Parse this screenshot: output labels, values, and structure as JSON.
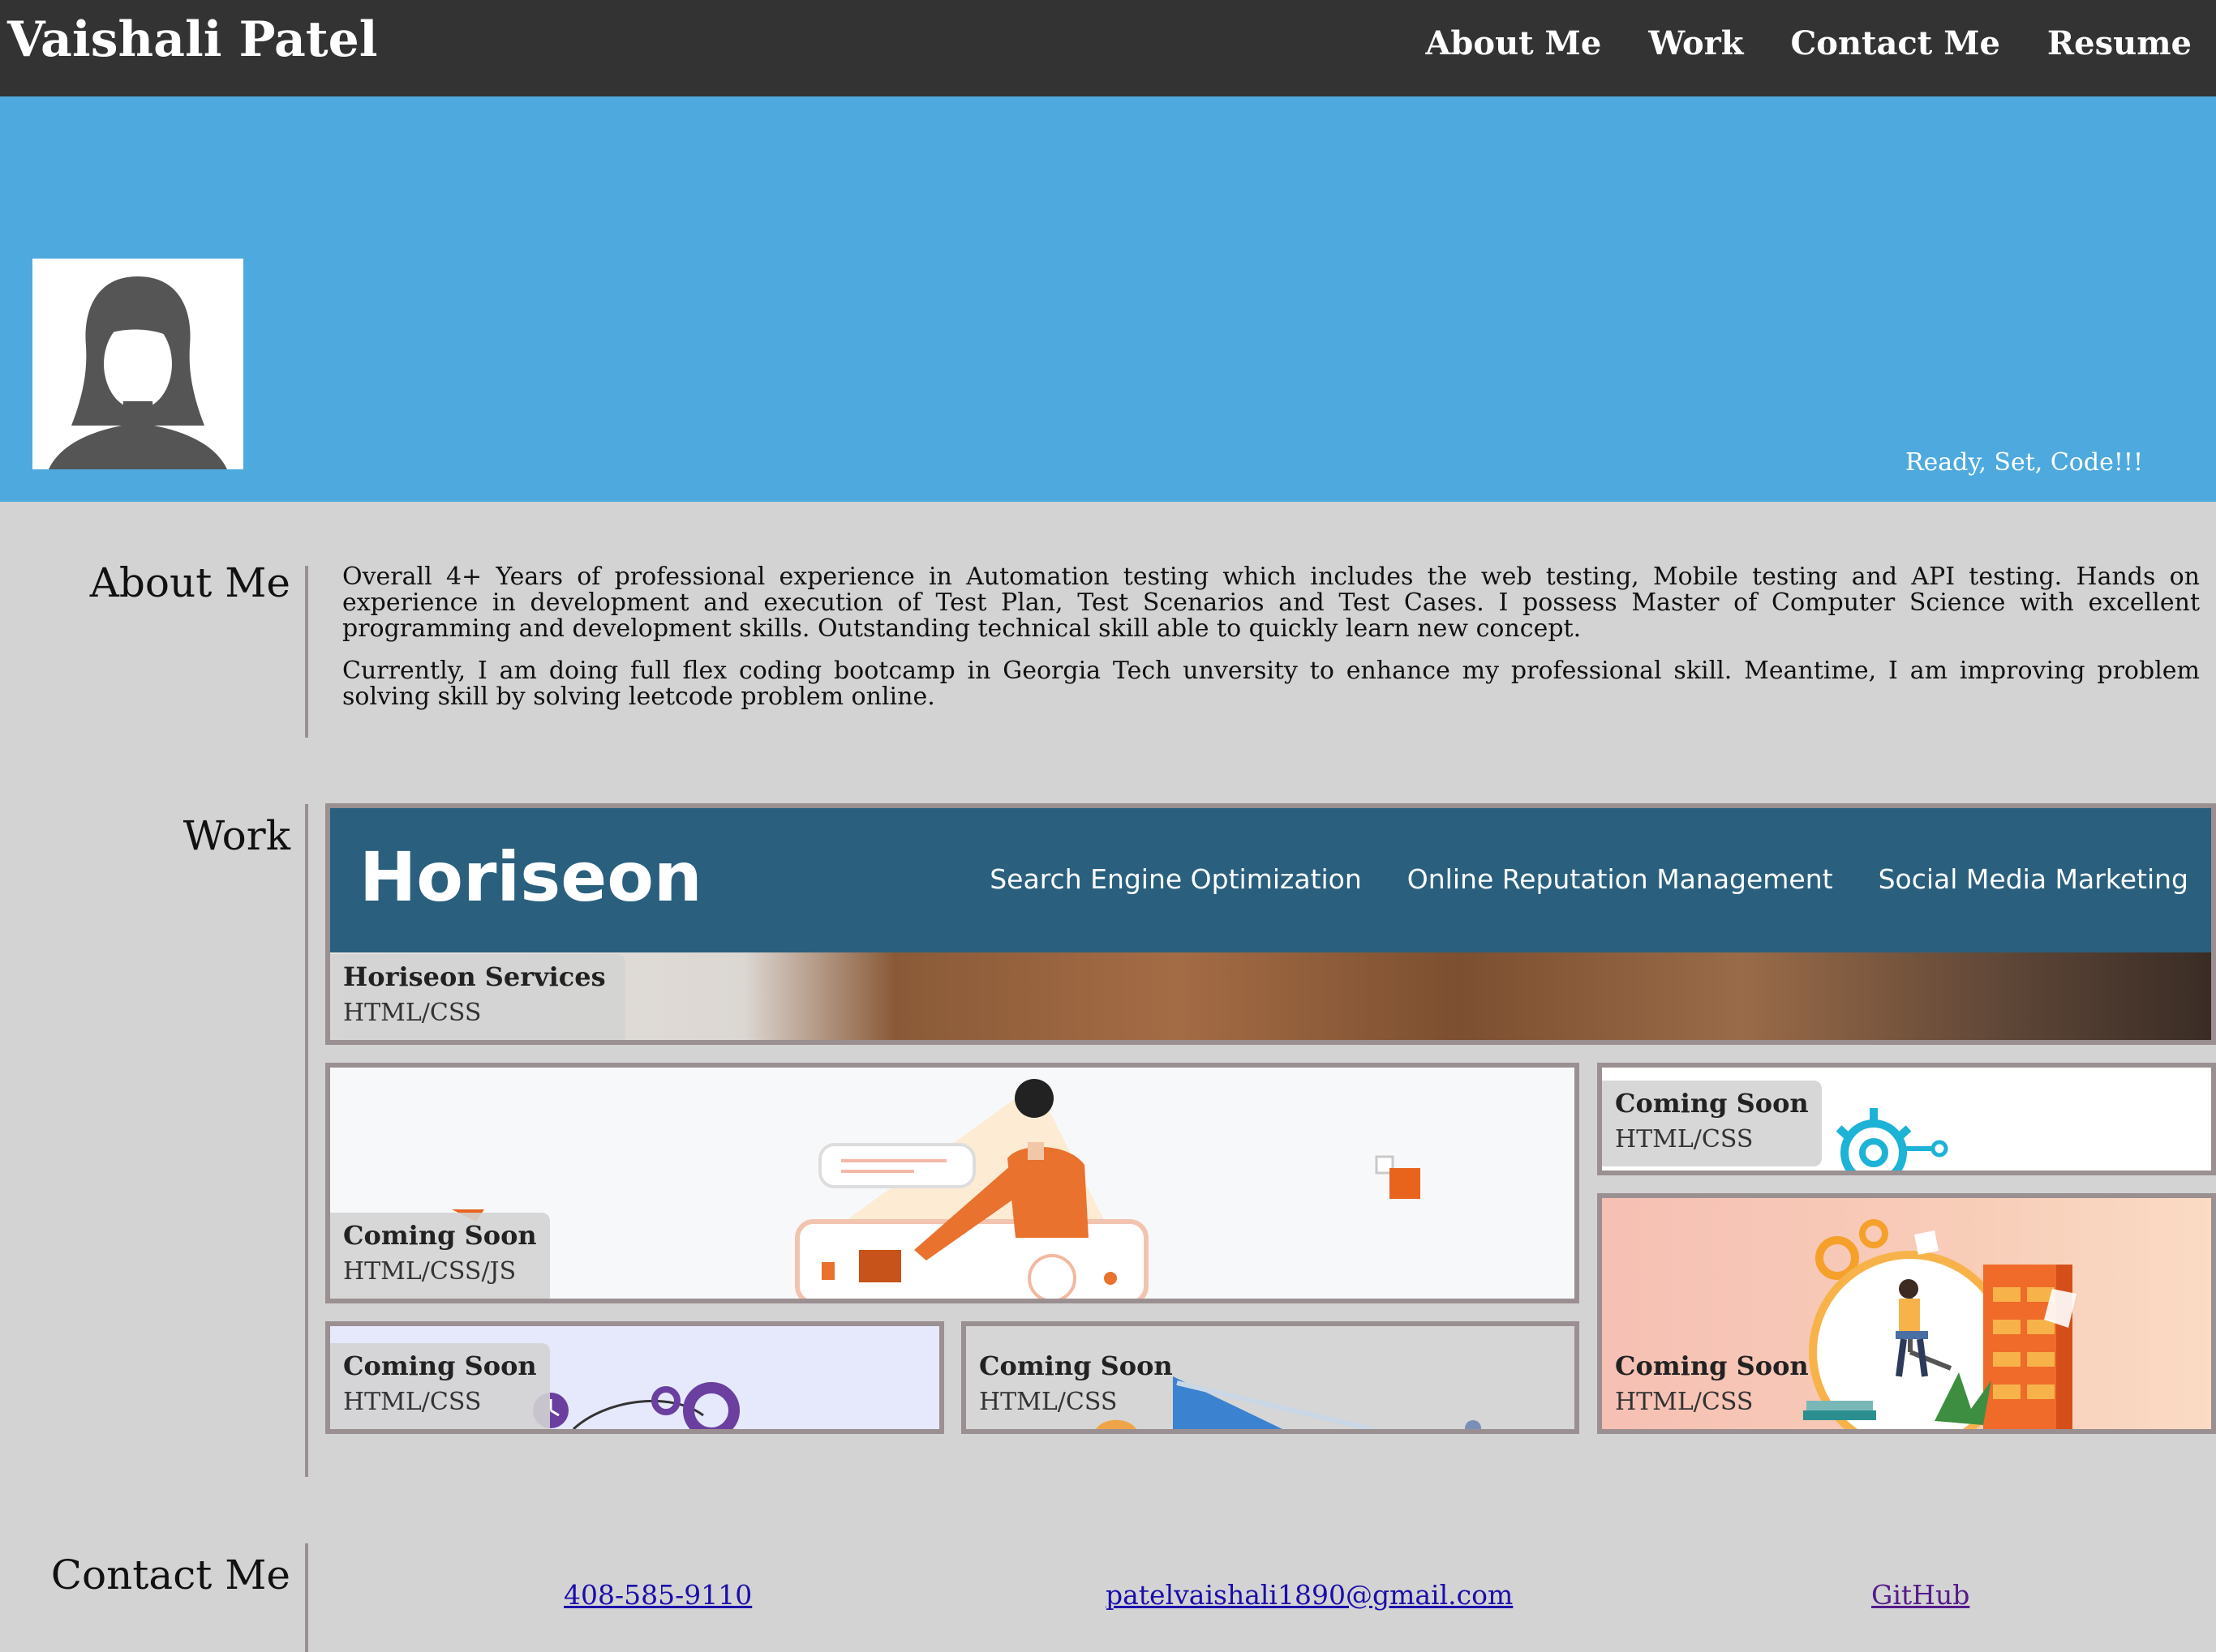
{
  "header": {
    "brand": "Vaishali Patel",
    "nav": [
      "About Me",
      "Work",
      "Contact Me",
      "Resume"
    ]
  },
  "hero": {
    "tagline": "Ready, Set, Code!!!",
    "avatar_icon": "female-avatar-placeholder"
  },
  "about": {
    "title": "About Me",
    "paragraphs": [
      "Overall 4+ Years of professional experience in Automation testing which includes the web testing, Mobile testing and API testing. Hands on experience in development and execution of Test Plan, Test Scenarios and Test Cases. I possess Master of Computer Science with excellent programming and development skills. Outstanding technical skill able to quickly learn new concept.",
      "Currently, I am doing full flex coding bootcamp in Georgia Tech unversity to enhance my professional skill. Meantime, I am improving problem solving skill by solving leetcode problem online."
    ]
  },
  "work": {
    "title": "Work",
    "featured": {
      "title": "Horiseon Services",
      "tech": "HTML/CSS",
      "screenshot": {
        "logo": "Horiseon",
        "nav": [
          "Search Engine Optimization",
          "Online Reputation Management",
          "Social Media Marketing"
        ]
      }
    },
    "projects": [
      {
        "title": "Coming Soon",
        "tech": "HTML/CSS/JS"
      },
      {
        "title": "Coming Soon",
        "tech": "HTML/CSS"
      },
      {
        "title": "Coming Soon",
        "tech": "HTML/CSS"
      },
      {
        "title": "Coming Soon",
        "tech": "HTML/CSS"
      },
      {
        "title": "Coming Soon",
        "tech": "HTML/CSS"
      }
    ]
  },
  "contact": {
    "title": "Contact Me",
    "phone": "408-585-9110",
    "email": "patelvaishali1890@gmail.com",
    "github": "GitHub"
  },
  "colors": {
    "topbar": "#333333",
    "hero": "#4eaade",
    "page": "#d3d3d3",
    "card_border": "#9a8f91",
    "link": "#1a0dab",
    "visited_link": "#551a8b"
  }
}
